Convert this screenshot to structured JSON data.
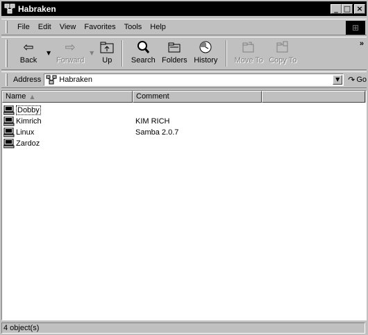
{
  "window": {
    "title": "Habraken"
  },
  "titlebar": {
    "minimize": "_",
    "maximize": "□",
    "close": "×"
  },
  "menu": {
    "items": [
      {
        "label": "File",
        "accel": "F"
      },
      {
        "label": "Edit",
        "accel": "E"
      },
      {
        "label": "View",
        "accel": "V"
      },
      {
        "label": "Favorites",
        "accel": "a"
      },
      {
        "label": "Tools",
        "accel": "T"
      },
      {
        "label": "Help",
        "accel": "H"
      }
    ]
  },
  "toolbar": {
    "back": "Back",
    "forward": "Forward",
    "up": "Up",
    "search": "Search",
    "folders": "Folders",
    "history": "History",
    "move_to": "Move To",
    "copy_to": "Copy To",
    "overflow": "»"
  },
  "address": {
    "label": "Address",
    "accel": "d",
    "value": "Habraken",
    "go_label": "Go"
  },
  "list": {
    "columns": {
      "name": "Name",
      "comment": "Comment"
    },
    "rows": [
      {
        "name": "Dobby",
        "comment": ""
      },
      {
        "name": "Kimrich",
        "comment": "KIM RICH"
      },
      {
        "name": "Linux",
        "comment": "Samba 2.0.7"
      },
      {
        "name": "Zardoz",
        "comment": ""
      }
    ]
  },
  "status": {
    "text": "4 object(s)"
  },
  "colors": {
    "title_bar": "#000000",
    "face": "#c0c0c0",
    "window": "#ffffff"
  }
}
